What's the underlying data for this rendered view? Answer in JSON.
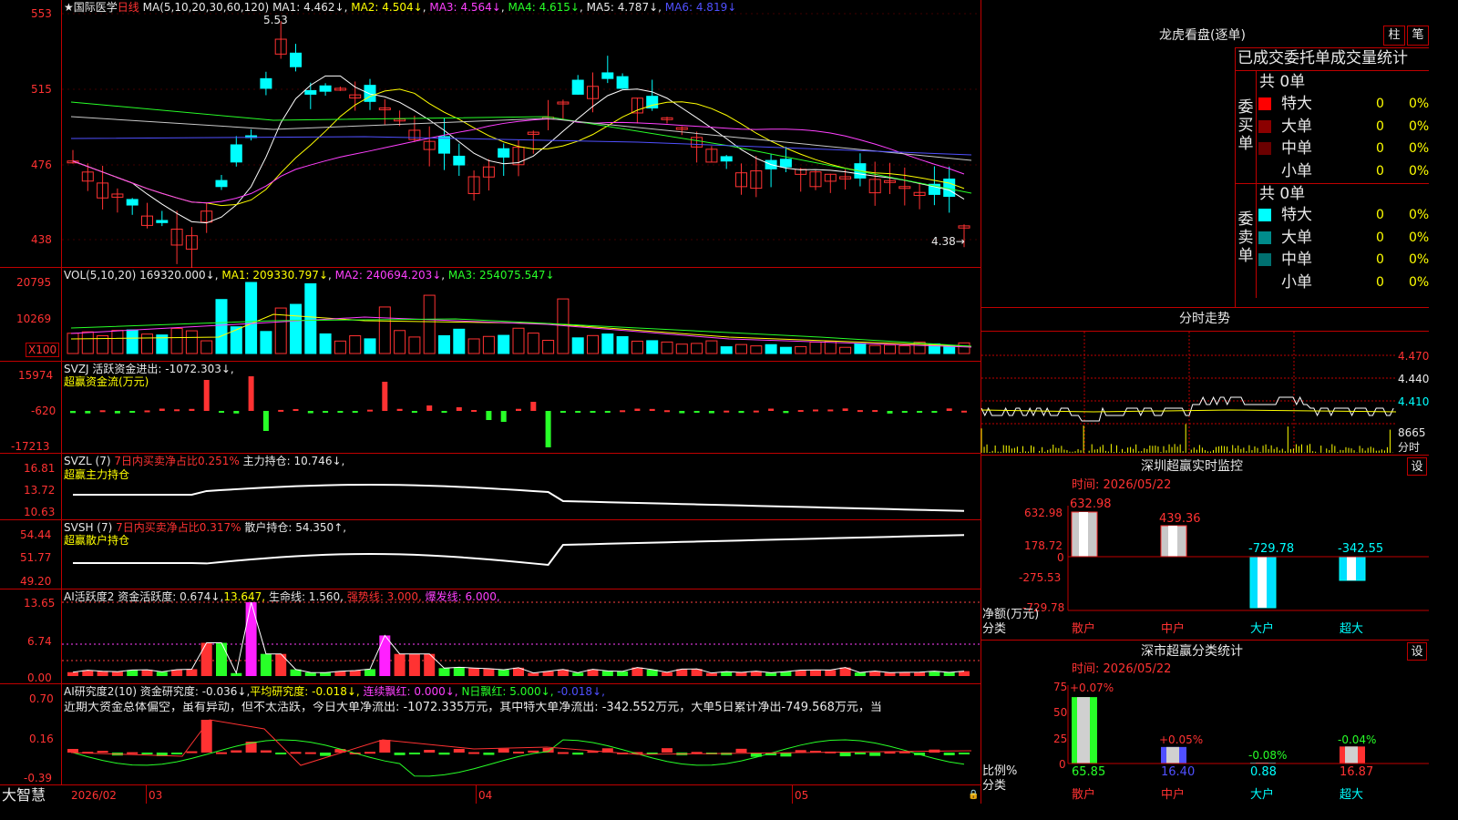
{
  "stock": {
    "star": "★",
    "name": "国际医学",
    "period": "日线"
  },
  "colors": {
    "up": "#ff3232",
    "down": "#00ffff",
    "bg": "#000000",
    "frame": "#c00000",
    "ma1": "#ffffff",
    "ma2": "#ffff00",
    "ma3": "#ff40ff",
    "ma4": "#28ff28",
    "ma5": "#c8c8c8",
    "ma6": "#5050ff"
  },
  "price_panel": {
    "ma_label": "MA(5,10,20,30,60,120)",
    "ma_values": [
      {
        "name": "MA1:",
        "value": "4.462↓"
      },
      {
        "name": "MA2:",
        "value": "4.504↓"
      },
      {
        "name": "MA3:",
        "value": "4.564↓"
      },
      {
        "name": "MA4:",
        "value": "4.615↓"
      },
      {
        "name": "MA5:",
        "value": "4.787↓"
      },
      {
        "name": "MA6:",
        "value": "4.819↓"
      }
    ],
    "axis": [
      "553",
      "515",
      "476",
      "438"
    ],
    "high_mark": "5.53",
    "low_mark": "4.38"
  },
  "vol_panel": {
    "label": "VOL(5,10,20)",
    "vol": "169320.000↓",
    "ma1": "MA1: 209330.797↓",
    "ma2": "MA2: 240694.203↓",
    "ma3": "MA3: 254075.547↓",
    "axis": [
      "20795",
      "10269"
    ],
    "unit": "X100"
  },
  "svzj_panel": {
    "label": "SVZJ",
    "desc": "活跃资金进出: -1072.303↓,",
    "sub": "超赢资金流(万元)",
    "axis": [
      "15974",
      "-620",
      "-17213"
    ]
  },
  "svzl_panel": {
    "label": "SVZL (7)",
    "ratio": "7日内买卖净占比0.251%",
    "hold": "主力持仓: 10.746↓,",
    "sub": "超赢主力持仓",
    "axis": [
      "16.81",
      "13.72",
      "10.63"
    ]
  },
  "svsh_panel": {
    "label": "SVSH (7)",
    "ratio": "7日内买卖净占比0.317%",
    "hold": "散户持仓: 54.350↑,",
    "sub": "超赢散户持仓",
    "axis": [
      "54.44",
      "51.77",
      "49.20"
    ]
  },
  "ai_active": {
    "label": "AI活跃度2",
    "v1": "资金活跃度: 0.674↓,",
    "v2": "13.647,",
    "v3": "生命线: 1.560,",
    "v4": "强势线: 3.000,",
    "v5": "爆发线: 6.000,",
    "axis": [
      "13.65",
      "6.74",
      "0.00"
    ]
  },
  "ai_research": {
    "label": "AI研究度2(10)",
    "v1": "资金研究度: -0.036↓,",
    "v2": "平均研究度: -0.018↓,",
    "v3": "连续飘红: 0.000↓,",
    "v4": "N日飘红: 5.000↓,",
    "v5": "-0.018↓,",
    "comment": "近期大资金总体偏空，虽有异动，但不太活跃，今日大单净流出: -1072.335万元，其中特大单净流出: -342.552万元，大单5日累计净出-749.568万元，当",
    "axis": [
      "0.70",
      "0.16",
      "-0.39"
    ]
  },
  "xaxis": {
    "brand": "大智慧",
    "labels": [
      "2026/02",
      "03",
      "04",
      "05"
    ]
  },
  "lhb": {
    "title": "龙虎看盘(逐单)",
    "btn1": "柱",
    "btn2": "笔",
    "subtitle": "已成交委托单成交量统计",
    "buy": {
      "side": "委买单",
      "total": "共 0单",
      "rows": [
        {
          "name": "特大",
          "v": "0",
          "p": "0%",
          "c": "#ff0000"
        },
        {
          "name": "大单",
          "v": "0",
          "p": "0%",
          "c": "#8b0000"
        },
        {
          "name": "中单",
          "v": "0",
          "p": "0%",
          "c": "#6b0000"
        },
        {
          "name": "小单",
          "v": "0",
          "p": "0%",
          "c": ""
        }
      ]
    },
    "sell": {
      "side": "委卖单",
      "total": "共 0单",
      "rows": [
        {
          "name": "特大",
          "v": "0",
          "p": "0%",
          "c": "#00ffff"
        },
        {
          "name": "大单",
          "v": "0",
          "p": "0%",
          "c": "#008b8b"
        },
        {
          "name": "中单",
          "v": "0",
          "p": "0%",
          "c": "#007070"
        },
        {
          "name": "小单",
          "v": "0",
          "p": "0%",
          "c": ""
        }
      ]
    }
  },
  "intraday": {
    "title": "分时走势",
    "axis": [
      "4.470",
      "4.440",
      "4.410"
    ],
    "vol": "8665",
    "vol_label": "分时"
  },
  "monitor": {
    "title": "深圳超赢实时监控",
    "btn": "设",
    "date": "时间: 2026/05/22",
    "axis": [
      "632.98",
      "178.72",
      "0",
      "-275.53",
      "-729.78"
    ],
    "ylabel": "净额(万元)",
    "xlabel": "分类",
    "bars": [
      {
        "cat": "散户",
        "val": "632.98"
      },
      {
        "cat": "中户",
        "val": "439.36"
      },
      {
        "cat": "大户",
        "val": "-729.78"
      },
      {
        "cat": "超大",
        "val": "-342.55"
      }
    ]
  },
  "classify": {
    "title": "深市超赢分类统计",
    "btn": "设",
    "date": "时间: 2026/05/22",
    "axis": [
      "75",
      "50",
      "25",
      "0"
    ],
    "ylabel": "比例%",
    "xlabel": "分类",
    "bars": [
      {
        "cat": "散户",
        "top": "+0.07%",
        "val": "65.85"
      },
      {
        "cat": "中户",
        "top": "+0.05%",
        "val": "16.40"
      },
      {
        "cat": "大户",
        "top": "-0.08%",
        "val": "0.88"
      },
      {
        "cat": "超大",
        "top": "-0.04%",
        "val": "16.87"
      }
    ]
  }
}
